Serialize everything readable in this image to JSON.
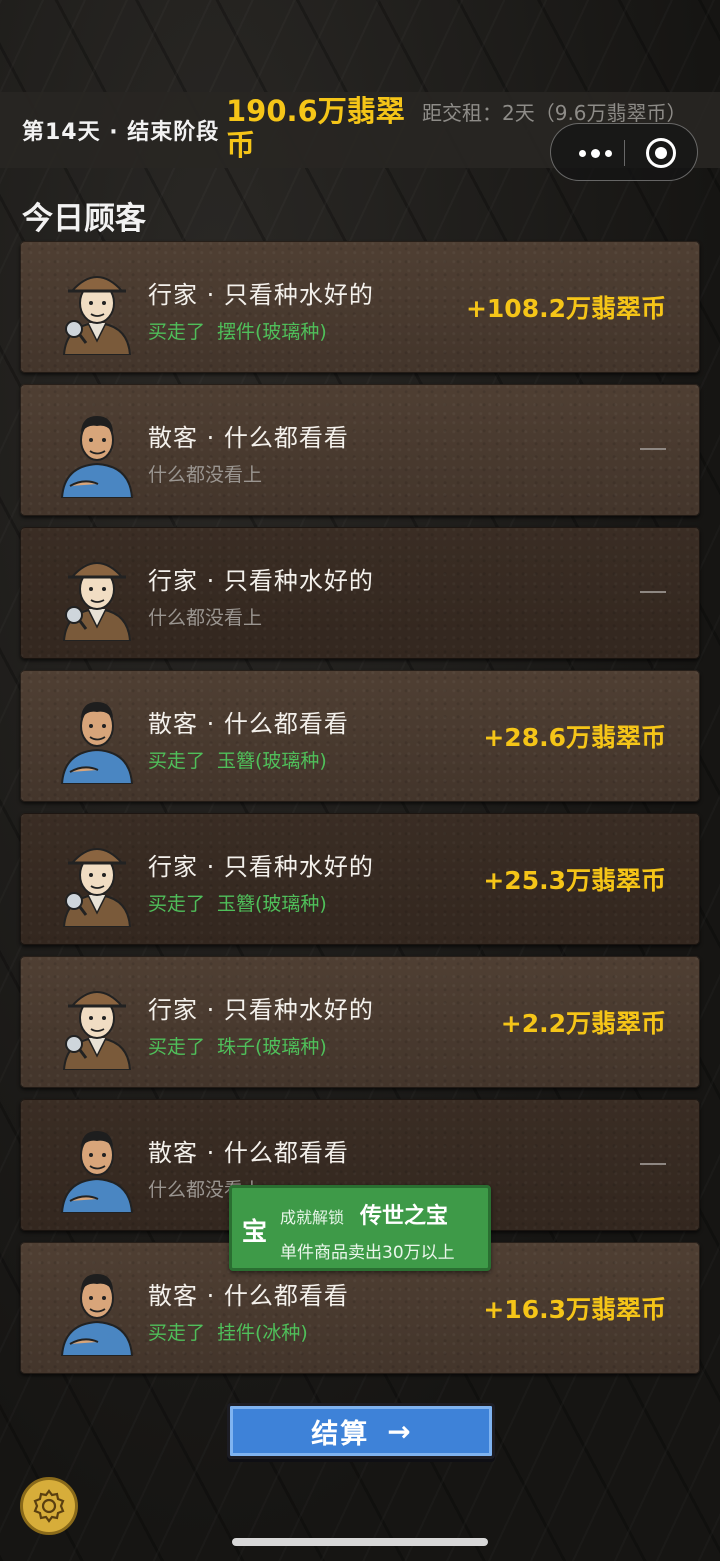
{
  "header": {
    "day_phase": "第14天 · 结束阶段",
    "money": "190.6万翡翠币",
    "rent": "距交租：2天（9.6万翡翠币）"
  },
  "section_title": "今日顾客",
  "customers": [
    {
      "type": "expert",
      "name": "行家 · 只看种水好的",
      "verb": "买走了",
      "item": "摆件(玻璃种)",
      "amount": "+108.2万翡翠币",
      "dark": false
    },
    {
      "type": "casual",
      "name": "散客 · 什么都看看",
      "verb": "",
      "item": "什么都没看上",
      "amount": "—",
      "dark": false
    },
    {
      "type": "expert",
      "name": "行家 · 只看种水好的",
      "verb": "",
      "item": "什么都没看上",
      "amount": "—",
      "dark": true
    },
    {
      "type": "casual",
      "name": "散客 · 什么都看看",
      "verb": "买走了",
      "item": "玉簪(玻璃种)",
      "amount": "+28.6万翡翠币",
      "dark": false
    },
    {
      "type": "expert",
      "name": "行家 · 只看种水好的",
      "verb": "买走了",
      "item": "玉簪(玻璃种)",
      "amount": "+25.3万翡翠币",
      "dark": true
    },
    {
      "type": "expert",
      "name": "行家 · 只看种水好的",
      "verb": "买走了",
      "item": "珠子(玻璃种)",
      "amount": "+2.2万翡翠币",
      "dark": false
    },
    {
      "type": "casual",
      "name": "散客 · 什么都看看",
      "verb": "",
      "item": "什么都没看上",
      "amount": "—",
      "dark": true
    },
    {
      "type": "casual",
      "name": "散客 · 什么都看看",
      "verb": "买走了",
      "item": "挂件(冰种)",
      "amount": "+16.3万翡翠币",
      "dark": false
    }
  ],
  "toast": {
    "icon_char": "宝",
    "label": "成就解锁",
    "title": "传世之宝",
    "subtitle": "单件商品卖出30万以上"
  },
  "settle_button": {
    "label": "结算",
    "arrow": "→"
  },
  "icons": {
    "settings": "gear-icon",
    "more": "more-dots-icon",
    "close": "mini-program-close-icon"
  },
  "colors": {
    "money": "#f5c518",
    "bought": "#4fbf5a",
    "none": "#9a9590",
    "button": "#3e82d8",
    "toast": "#3e9a48"
  }
}
